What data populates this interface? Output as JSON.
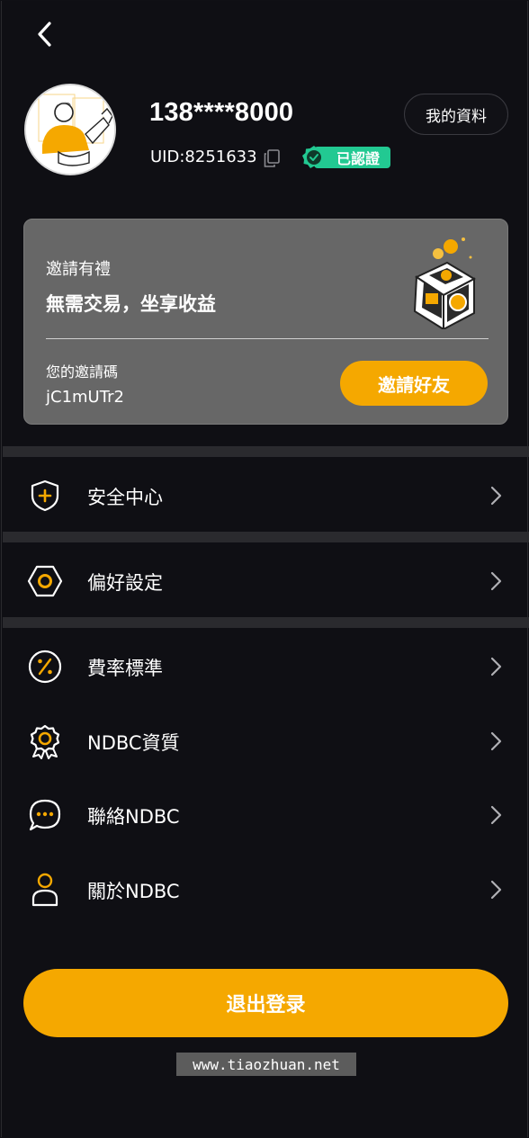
{
  "header": {
    "back_icon": "chevron-left-icon"
  },
  "profile": {
    "phone": "138****8000",
    "uid": "UID:8251633",
    "verified_label": "已認證",
    "profile_button": "我的資料",
    "avatar_icon": "avatar-illustration"
  },
  "invite": {
    "title": "邀請有禮",
    "subtitle": "無需交易，坐享收益",
    "code_label": "您的邀請碼",
    "code_value": "jC1mUTr2",
    "button_label": "邀請好友"
  },
  "menu": [
    {
      "label": "安全中心",
      "icon": "shield-icon"
    },
    {
      "label": "偏好設定",
      "icon": "hexagon-settings-icon"
    },
    {
      "label": "費率標準",
      "icon": "percent-icon"
    },
    {
      "label": "NDBC資質",
      "icon": "award-badge-icon"
    },
    {
      "label": "聯絡NDBC",
      "icon": "chat-bubble-icon"
    },
    {
      "label": "關於NDBC",
      "icon": "user-icon"
    }
  ],
  "logout_label": "退出登录",
  "watermark": "www.tiaozhuan.net",
  "colors": {
    "accent": "#f5a800",
    "verified": "#22c992",
    "background": "#0f0f14",
    "card": "#676767"
  }
}
